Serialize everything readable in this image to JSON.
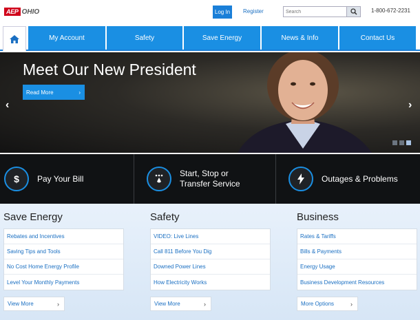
{
  "header": {
    "logo_brand": "AEP",
    "logo_region": "OHIO",
    "login_label": "Log In",
    "register_label": "Register",
    "search_placeholder": "Search",
    "phone": "1-800-672-2231"
  },
  "nav": {
    "items": [
      {
        "label": "My Account"
      },
      {
        "label": "Safety"
      },
      {
        "label": "Save Energy"
      },
      {
        "label": "News & Info"
      },
      {
        "label": "Contact Us"
      }
    ]
  },
  "hero": {
    "title": "Meet Our New President",
    "cta_label": "Read More",
    "slide_count": 3,
    "active_slide": 3
  },
  "quick_links": [
    {
      "label_line1": "Pay Your Bill",
      "label_line2": "",
      "icon": "dollar-icon"
    },
    {
      "label_line1": "Start, Stop or",
      "label_line2": "Transfer Service",
      "icon": "service-icon"
    },
    {
      "label_line1": "Outages & Problems",
      "label_line2": "",
      "icon": "lightning-icon"
    }
  ],
  "sections": [
    {
      "title": "Save Energy",
      "links": [
        "Rebates and Incentives",
        "Saving Tips and Tools",
        "No Cost Home Energy Profile",
        "Level Your Monthly Payments"
      ],
      "more_label": "View More"
    },
    {
      "title": "Safety",
      "links": [
        "VIDEO: Live Lines",
        "Call 811 Before You Dig",
        "Downed Power Lines",
        "How Electricity Works"
      ],
      "more_label": "View More"
    },
    {
      "title": "Business",
      "links": [
        "Rates & Tariffs",
        "Bills & Payments",
        "Energy Usage",
        "Business Development Resources"
      ],
      "more_label": "More Options"
    }
  ],
  "colors": {
    "accent": "#1a8fe3",
    "brand_red": "#d0021b",
    "dark_strip": "#101214"
  }
}
